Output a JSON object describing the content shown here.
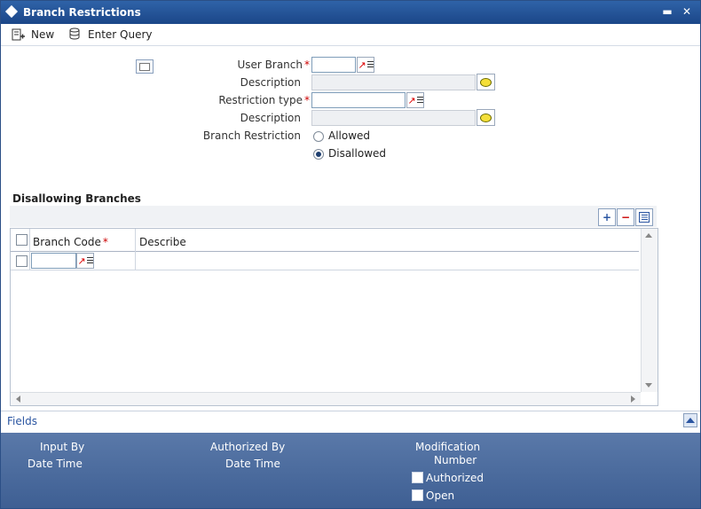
{
  "window": {
    "title": "Branch Restrictions",
    "minimize_label": "▬",
    "close_label": "✕"
  },
  "toolbar": {
    "new_label": "New",
    "enter_query_label": "Enter Query"
  },
  "form": {
    "user_branch_label": "User Branch",
    "description_label_1": "Description",
    "restriction_type_label": "Restriction type",
    "description_label_2": "Description",
    "branch_restriction_label": "Branch Restriction",
    "radio_allowed": "Allowed",
    "radio_disallowed": "Disallowed",
    "selected_restriction": "Disallowed",
    "required_mark": "*"
  },
  "disallowing": {
    "title": "Disallowing Branches",
    "columns": [
      "Branch Code",
      "Describe"
    ],
    "required_mark": "*",
    "add_label": "+",
    "remove_label": "−"
  },
  "fields": {
    "label": "Fields"
  },
  "footer": {
    "input_by": "Input By",
    "date_time_1": "Date Time",
    "authorized_by": "Authorized By",
    "date_time_2": "Date Time",
    "modification": "Modification",
    "number": "Number",
    "authorized": "Authorized",
    "open": "Open"
  },
  "colors": {
    "title_bar": "#1f4c8f",
    "footer": "#4a6b9e",
    "required": "#cc0000"
  }
}
